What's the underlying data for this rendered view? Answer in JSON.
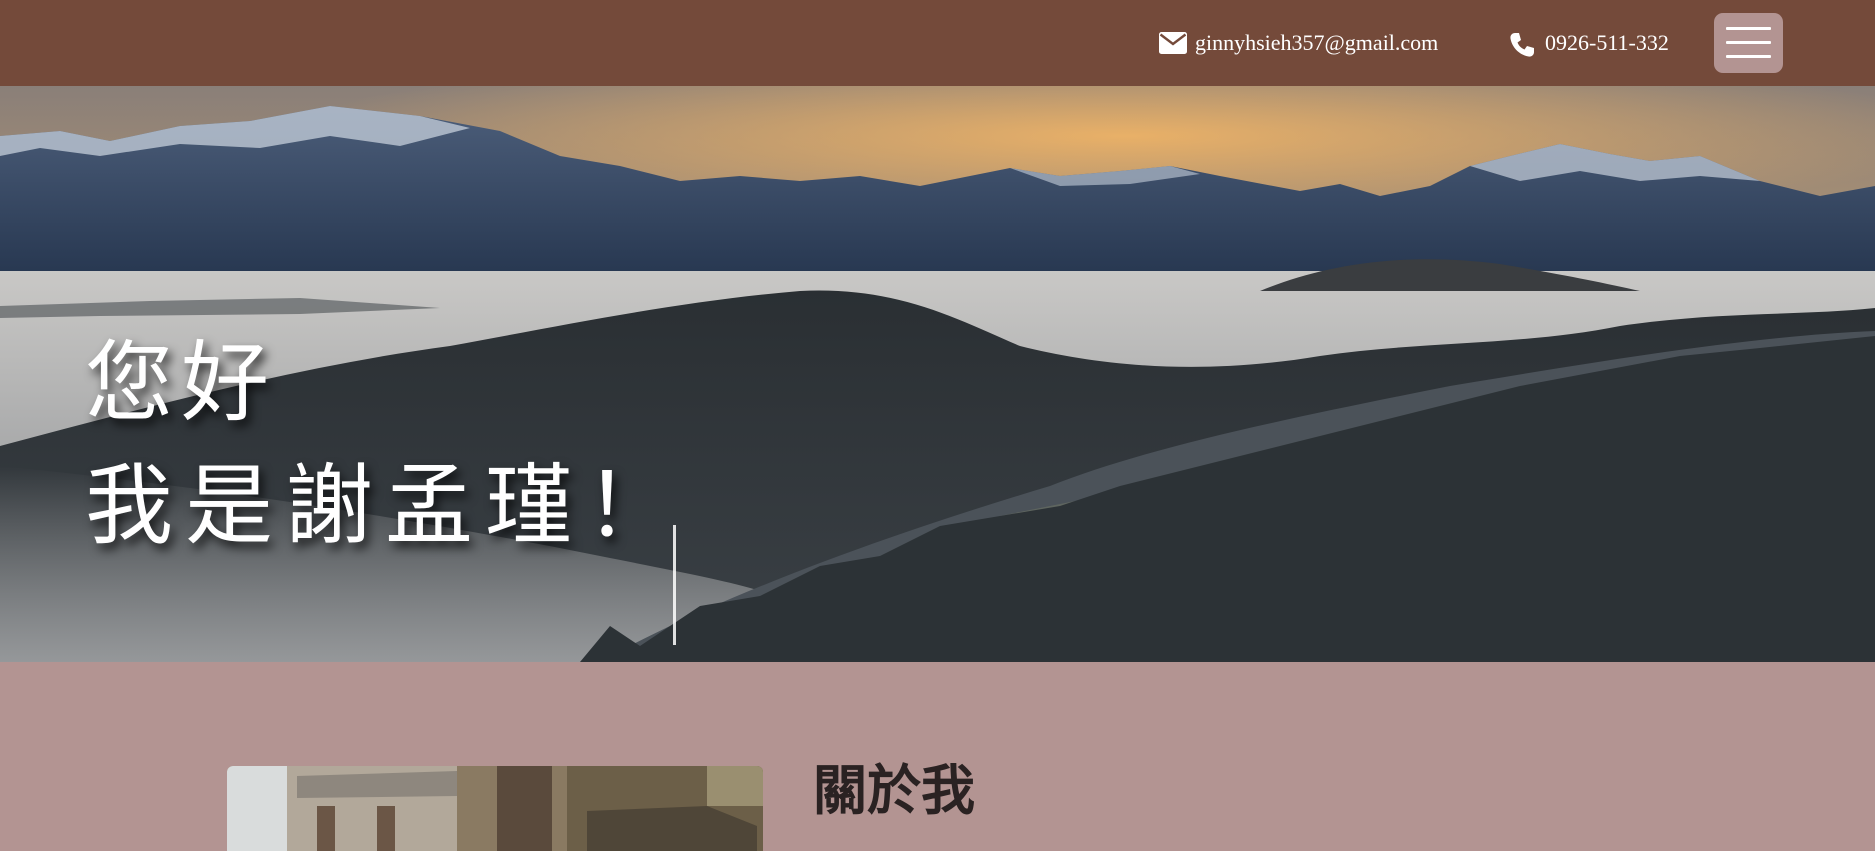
{
  "header": {
    "email": "ginnyhsieh357@gmail.com",
    "phone": "0926-511-332",
    "email_icon": "envelope-icon",
    "phone_icon": "phone-icon",
    "menu_icon": "hamburger-menu-icon",
    "background_color": "#744a3a",
    "menu_button_color": "#b39492"
  },
  "hero": {
    "greeting": "您好",
    "intro": "我是謝孟瑾！",
    "image": "misty mountain forest landscape at sunset"
  },
  "about": {
    "title": "關於我",
    "photo": "wooden shrine with hanging wishes",
    "background_color": "#b39492"
  }
}
